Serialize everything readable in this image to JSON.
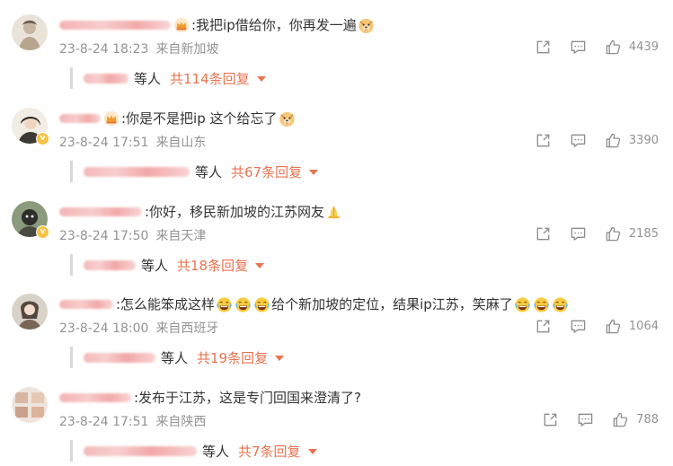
{
  "comments": [
    {
      "text": ":我把ip借给你，你再发一遍",
      "time": "23-8-24 18:23",
      "location": "来自新加坡",
      "likes": "4439",
      "reply_suffix": "等人",
      "reply_count": "共114条回复"
    },
    {
      "text": ":你是不是把ip 这个给忘了",
      "time": "23-8-24 17:51",
      "location": "来自山东",
      "likes": "3390",
      "reply_suffix": "等人",
      "reply_count": "共67条回复"
    },
    {
      "text": ":你好，移民新加坡的江苏网友",
      "time": "23-8-24 17:50",
      "location": "来自天津",
      "likes": "2185",
      "reply_suffix": "等人",
      "reply_count": "共18条回复"
    },
    {
      "text_a": ":怎么能笨成这样",
      "text_b": "给个新加坡的定位，结果ip江苏，笑麻了",
      "time": "23-8-24 18:00",
      "location": "来自西班牙",
      "likes": "1064",
      "reply_suffix": "等人",
      "reply_count": "共19条回复"
    },
    {
      "text": ":发布于江苏，这是专门回国来澄清了?",
      "time": "23-8-24 17:51",
      "location": "来自陕西",
      "likes": "788",
      "reply_suffix": "等人",
      "reply_count": "共7条回复"
    }
  ],
  "colors": {
    "accent": "#eb7350",
    "text": "#333333",
    "meta": "#939393",
    "verified": "#f7c344"
  },
  "icons": [
    "share-icon",
    "reply-icon",
    "like-icon",
    "crown-icon",
    "doge-emoji",
    "pray-emoji",
    "laugh-cry-emoji"
  ]
}
